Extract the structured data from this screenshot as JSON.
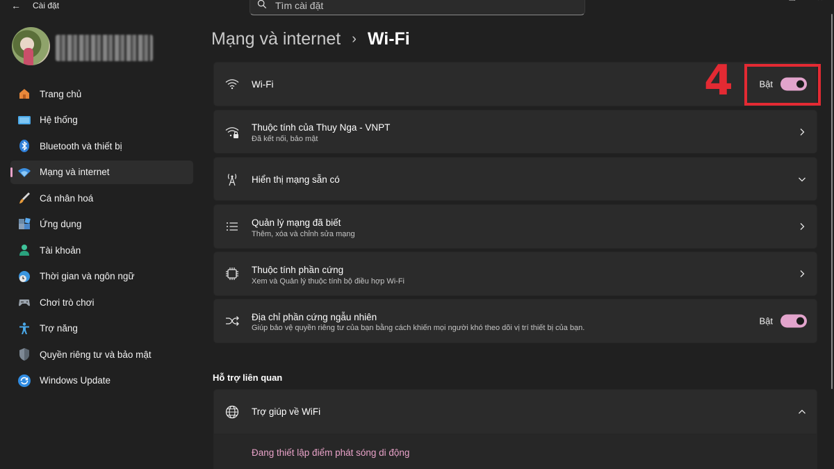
{
  "window": {
    "app_title": "Cài đặt",
    "back_glyph": "←",
    "controls": [
      "─",
      "❐",
      "✕"
    ]
  },
  "search": {
    "placeholder": "Tìm cài đặt"
  },
  "sidebar": {
    "items": [
      {
        "label": "Trang chủ",
        "icon": "home-icon",
        "active": false
      },
      {
        "label": "Hệ thống",
        "icon": "system-icon",
        "active": false
      },
      {
        "label": "Bluetooth và thiết bị",
        "icon": "bluetooth-icon",
        "active": false
      },
      {
        "label": "Mạng và internet",
        "icon": "wifi-icon",
        "active": true
      },
      {
        "label": "Cá nhân hoá",
        "icon": "brush-icon",
        "active": false
      },
      {
        "label": "Ứng dụng",
        "icon": "apps-icon",
        "active": false
      },
      {
        "label": "Tài khoản",
        "icon": "account-icon",
        "active": false
      },
      {
        "label": "Thời gian và ngôn ngữ",
        "icon": "globe-clock-icon",
        "active": false
      },
      {
        "label": "Chơi trò chơi",
        "icon": "gamepad-icon",
        "active": false
      },
      {
        "label": "Trợ năng",
        "icon": "accessibility-icon",
        "active": false
      },
      {
        "label": "Quyền riêng tư và bảo mật",
        "icon": "shield-icon",
        "active": false
      },
      {
        "label": "Windows Update",
        "icon": "update-icon",
        "active": false
      }
    ]
  },
  "breadcrumb": {
    "parent": "Mạng và internet",
    "separator": "›",
    "current": "Wi-Fi"
  },
  "cards": {
    "wifi": {
      "title": "Wi-Fi",
      "toggle_label": "Bật",
      "toggle_on": true
    },
    "properties": {
      "title": "Thuộc tính của Thuy Nga - VNPT",
      "subtitle": "Đã kết nối, bảo mật"
    },
    "available": {
      "title": "Hiển thị mạng sẵn có"
    },
    "manage": {
      "title": "Quản lý mạng đã biết",
      "subtitle": "Thêm, xóa và chỉnh sửa mạng"
    },
    "hardware": {
      "title": "Thuộc tính phần cứng",
      "subtitle": "Xem và Quản lý thuộc tính bộ điều hợp Wi-Fi"
    },
    "random_mac": {
      "title": "Địa chỉ phần cứng ngẫu nhiên",
      "subtitle": "Giúp bảo vệ quyền riêng tư của bạn bằng cách khiến mọi người khó theo dõi vị trí thiết bị của bạn.",
      "toggle_label": "Bật",
      "toggle_on": true
    }
  },
  "annotation": {
    "step_number": "4",
    "color": "#e32a33"
  },
  "related": {
    "section_title": "Hỗ trợ liên quan",
    "help_title": "Trợ giúp về WiFi",
    "links": [
      "Đang thiết lập điểm phát sóng di động"
    ]
  },
  "colors": {
    "accent": "#e8a2c8",
    "toggle_on": "#e2a4cc",
    "background": "#202020",
    "card": "#2b2b2b"
  }
}
